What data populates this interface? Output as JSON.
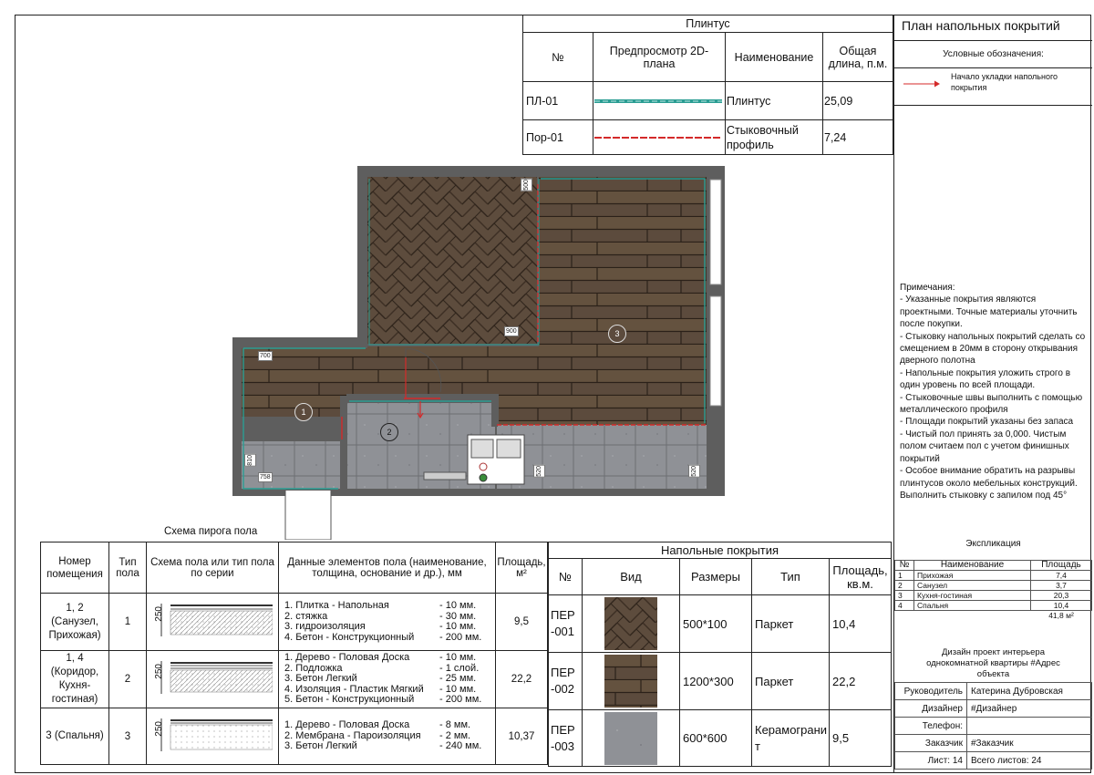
{
  "title_block": {
    "title": "План напольных покрытий",
    "legend_title": "Условные обозначения:",
    "legend_items": [
      {
        "label": "Начало укладки напольного покрытия"
      }
    ],
    "notes_title": "Примечания:",
    "notes": [
      "- Указанные покрытия являются проектными. Точные материалы уточнить после покупки.",
      "- Стыковку напольных покрытий сделать со смещением в 20мм в сторону открывания дверного полотна",
      "- Напольные покрытия уложить строго в один уровень по всей площади.",
      "- Стыковочные швы выполнить с помощью металлического профиля",
      "- Площади покрытий указаны без запаса",
      "- Чистый пол принять за 0,000. Чистым полом считаем пол с учетом финишных покрытий",
      "- Особое внимание обратить на разрывы плинтусов около мебельных конструкций. Выполнить стыковку с запилом под 45°"
    ],
    "explication": {
      "title": "Экспликация",
      "headers": [
        "№",
        "Наименование",
        "Площадь"
      ],
      "rows": [
        {
          "no": "1",
          "name": "Прихожая",
          "area": "7,4"
        },
        {
          "no": "2",
          "name": "Санузел",
          "area": "3,7"
        },
        {
          "no": "3",
          "name": "Кухня-гостиная",
          "area": "20,3"
        },
        {
          "no": "4",
          "name": "Спальня",
          "area": "10,4"
        }
      ],
      "total": "41,8 м²"
    },
    "project": "Дизайн проект интерьера однокомнатной квартиры #Адрес объекта",
    "signatures": [
      {
        "role": "Руководитель",
        "value": "Катерина Дубровская"
      },
      {
        "role": "Дизайнер",
        "value": "#Дизайнер"
      },
      {
        "role": "Телефон:",
        "value": ""
      },
      {
        "role": "Заказчик",
        "value": "#Заказчик"
      }
    ],
    "sheet": "Лист: 14",
    "sheets_total": "Всего листов: 24"
  },
  "baseboard_table": {
    "title": "Плинтус",
    "headers": [
      "№",
      "Предпросмотр 2D-плана",
      "Наименование",
      "Общая длина, п.м."
    ],
    "rows": [
      {
        "no": "ПЛ-01",
        "name": "Плинтус",
        "length": "25,09",
        "color": "#2a9d93"
      },
      {
        "no": "Пор-01",
        "name": "Стыковочный профиль",
        "length": "7,24",
        "color": "#d42a2a"
      }
    ]
  },
  "plan": {
    "dims": {
      "d500": "500",
      "d900": "900",
      "d700": "700",
      "d810": "810",
      "d758": "758",
      "d520a": "520",
      "d520b": "520"
    },
    "room_labels": [
      "1",
      "2",
      "3"
    ]
  },
  "floor_cake": {
    "title": "Схема пирога пола",
    "headers": [
      "Номер помещения",
      "Тип пола",
      "Схема пола или тип пола по серии",
      "Данные элементов пола (наименование, толщина, основание и др.), мм",
      "Площадь, м²"
    ],
    "rows": [
      {
        "rooms": "1, 2 (Санузел, Прихожая)",
        "type": "1",
        "scheme_dim": "250",
        "layers": [
          {
            "name": "1. Плитка - Напольная",
            "thick": "- 10 мм."
          },
          {
            "name": "2. стяжка",
            "thick": "- 30 мм."
          },
          {
            "name": "3. гидроизоляция",
            "thick": "- 10 мм."
          },
          {
            "name": "4. Бетон - Конструкционный",
            "thick": "- 200 мм."
          }
        ],
        "area": "9,5"
      },
      {
        "rooms": "1, 4 (Коридор, Кухня-гостиная)",
        "type": "2",
        "scheme_dim": "250",
        "layers": [
          {
            "name": "1. Дерево - Половая Доска",
            "thick": "- 10 мм."
          },
          {
            "name": "2. Подложка",
            "thick": "- 1 слой."
          },
          {
            "name": "3. Бетон Легкий",
            "thick": "- 25 мм."
          },
          {
            "name": "4. Изоляция - Пластик Мягкий",
            "thick": "- 10 мм."
          },
          {
            "name": "5. Бетон - Конструкционный",
            "thick": "- 200 мм."
          }
        ],
        "area": "22,2"
      },
      {
        "rooms": "3 (Спальня)",
        "type": "3",
        "scheme_dim": "250",
        "layers": [
          {
            "name": "1. Дерево - Половая Доска",
            "thick": "- 8 мм."
          },
          {
            "name": "2. Мембрана - Пароизоляция",
            "thick": "- 2 мм."
          },
          {
            "name": "3. Бетон Легкий",
            "thick": "- 240 мм."
          }
        ],
        "area": "10,37"
      }
    ]
  },
  "floor_coverings": {
    "title": "Напольные покрытия",
    "headers": [
      "№",
      "Вид",
      "Размеры",
      "Тип",
      "Площадь, кв.м."
    ],
    "rows": [
      {
        "no": "ПЕР -001",
        "pattern": "herringbone-wood",
        "size": "500*100",
        "type": "Паркет",
        "area": "10,4"
      },
      {
        "no": "ПЕР -002",
        "pattern": "plank-wood",
        "size": "1200*300",
        "type": "Паркет",
        "area": "22,2"
      },
      {
        "no": "ПЕР -003",
        "pattern": "grey-tile",
        "size": "600*600",
        "type": "Керамогранит",
        "area": "9,5"
      }
    ]
  },
  "colors": {
    "baseboard": "#2a9d93",
    "profile": "#d42a2a",
    "wood": "#5a4a3c",
    "tile": "#8e9095",
    "wall": "#5e5e5e"
  }
}
